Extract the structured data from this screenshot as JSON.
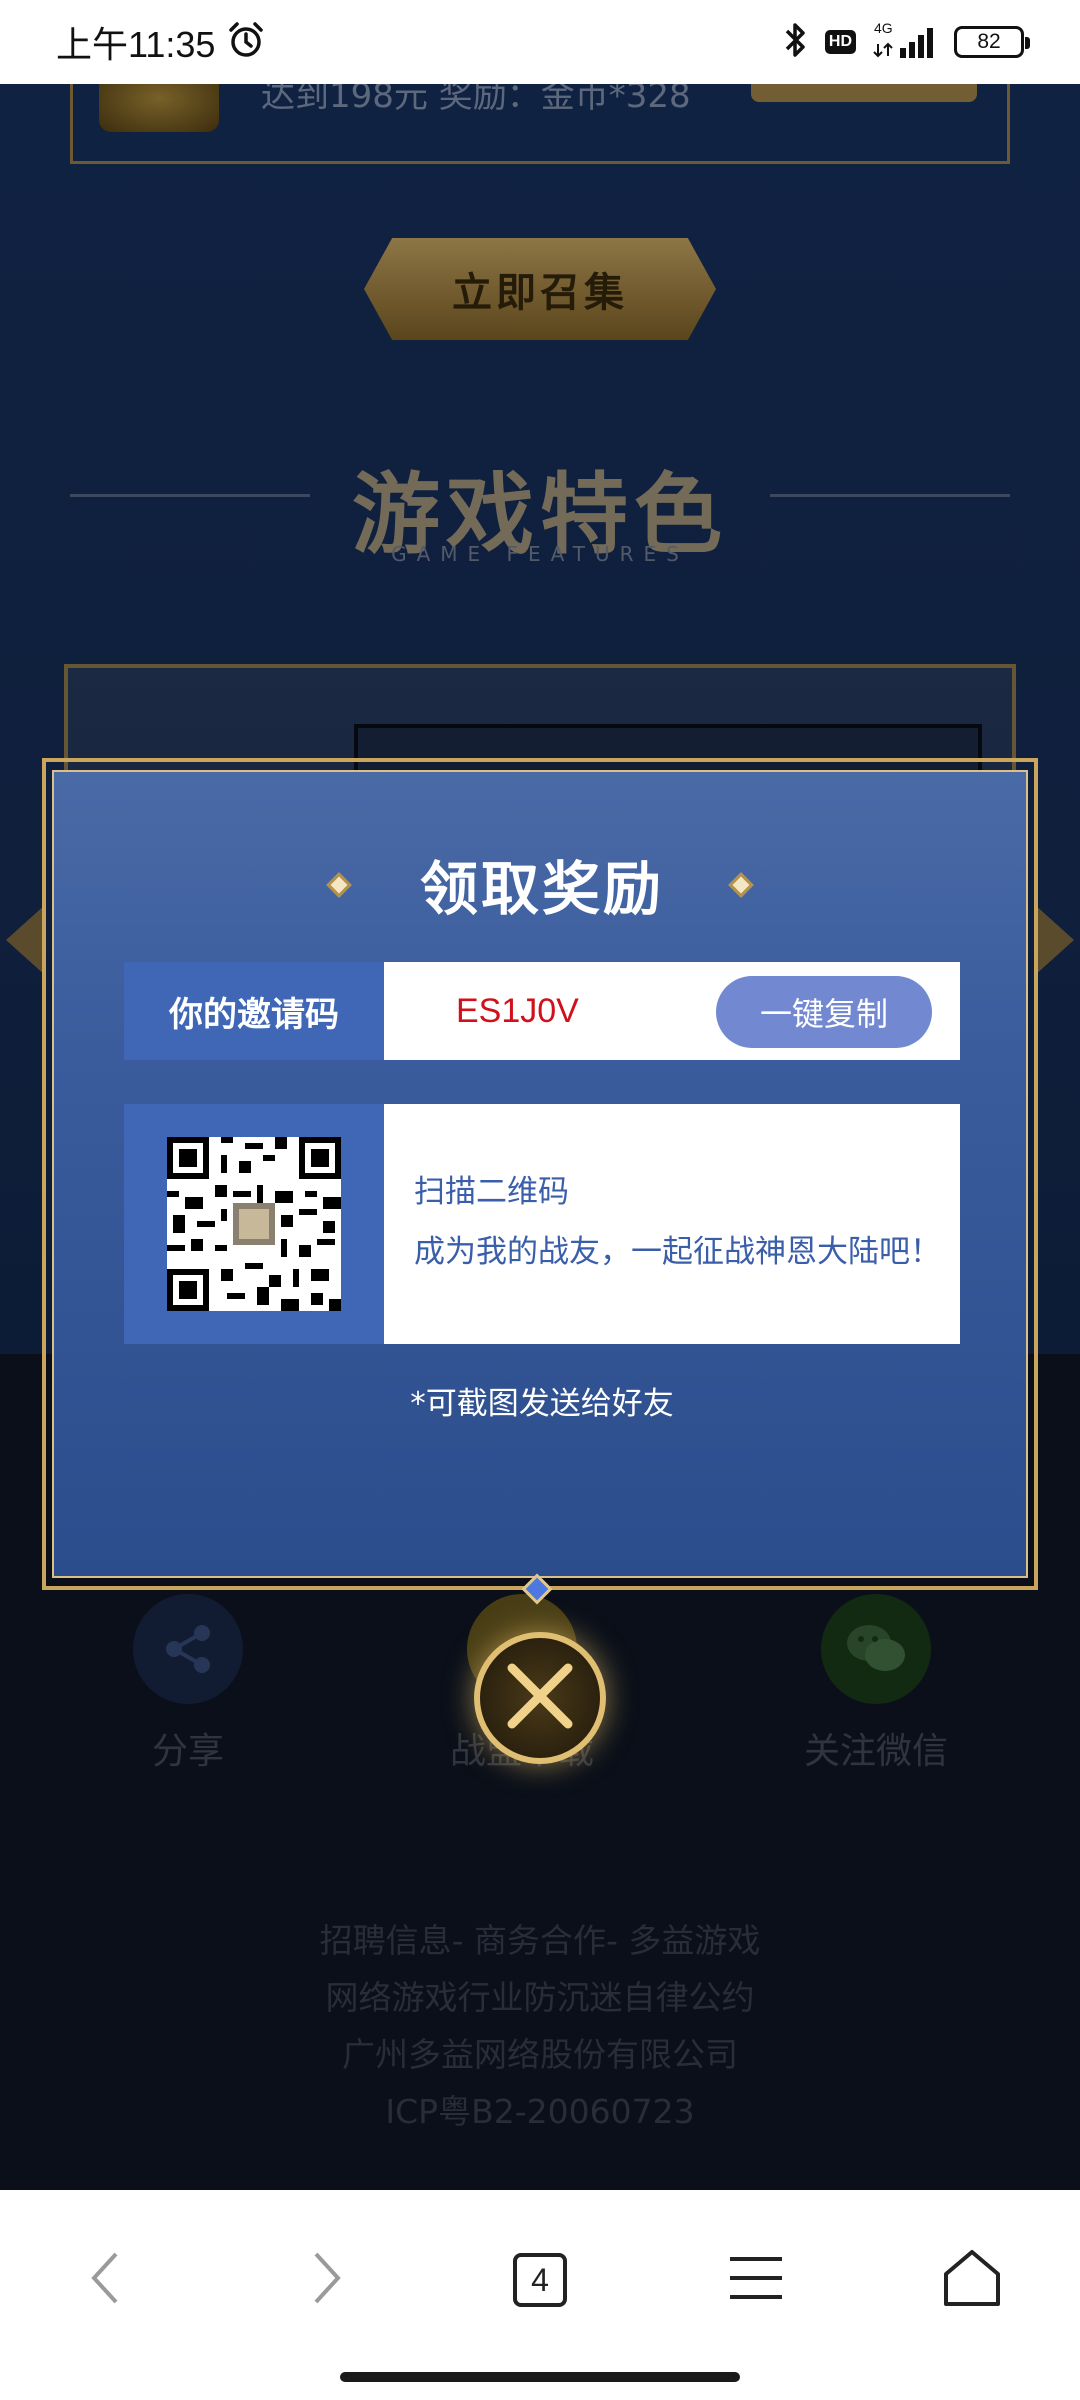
{
  "status_bar": {
    "time": "上午11:35",
    "network": "4G",
    "hd": "HD",
    "battery": "82"
  },
  "background": {
    "reward_text": "达到198元 奖励：金币*328",
    "summon_button": "立即召集",
    "features_title": "游戏特色",
    "features_subtitle": "GAME FEATURES",
    "actions": {
      "share": "分享",
      "download": "战盟下载",
      "wechat": "关注微信"
    },
    "footer": {
      "links": "招聘信息- 商务合作- 多益游戏",
      "self_discipline": "网络游戏行业防沉迷自律公约",
      "company": "广州多益网络股份有限公司",
      "icp": "ICP粤B2-20060723"
    }
  },
  "modal": {
    "title": "领取奖励",
    "invite_label": "你的邀请码",
    "invite_code": "ES1J0V",
    "copy_button": "一键复制",
    "qr_line1": "扫描二维码",
    "qr_line2": "成为我的战友，一起征战神恩大陆吧！",
    "hint": "*可截图发送给好友"
  },
  "browser": {
    "tab_count": "4"
  },
  "colors": {
    "modal_bg": "#3a5c9c",
    "label_bg": "#3f67b5",
    "copy_button": "#7289d2",
    "invite_code": "#d0111b",
    "gold_border": "#c9a65c"
  },
  "icons": {
    "alarm": "alarm-icon",
    "bluetooth": "bluetooth-icon",
    "signal": "signal-icon",
    "share": "share-icon",
    "wechat": "wechat-icon",
    "close": "close-icon",
    "back": "chevron-left-icon",
    "forward": "chevron-right-icon",
    "menu": "menu-icon",
    "home": "home-icon"
  }
}
